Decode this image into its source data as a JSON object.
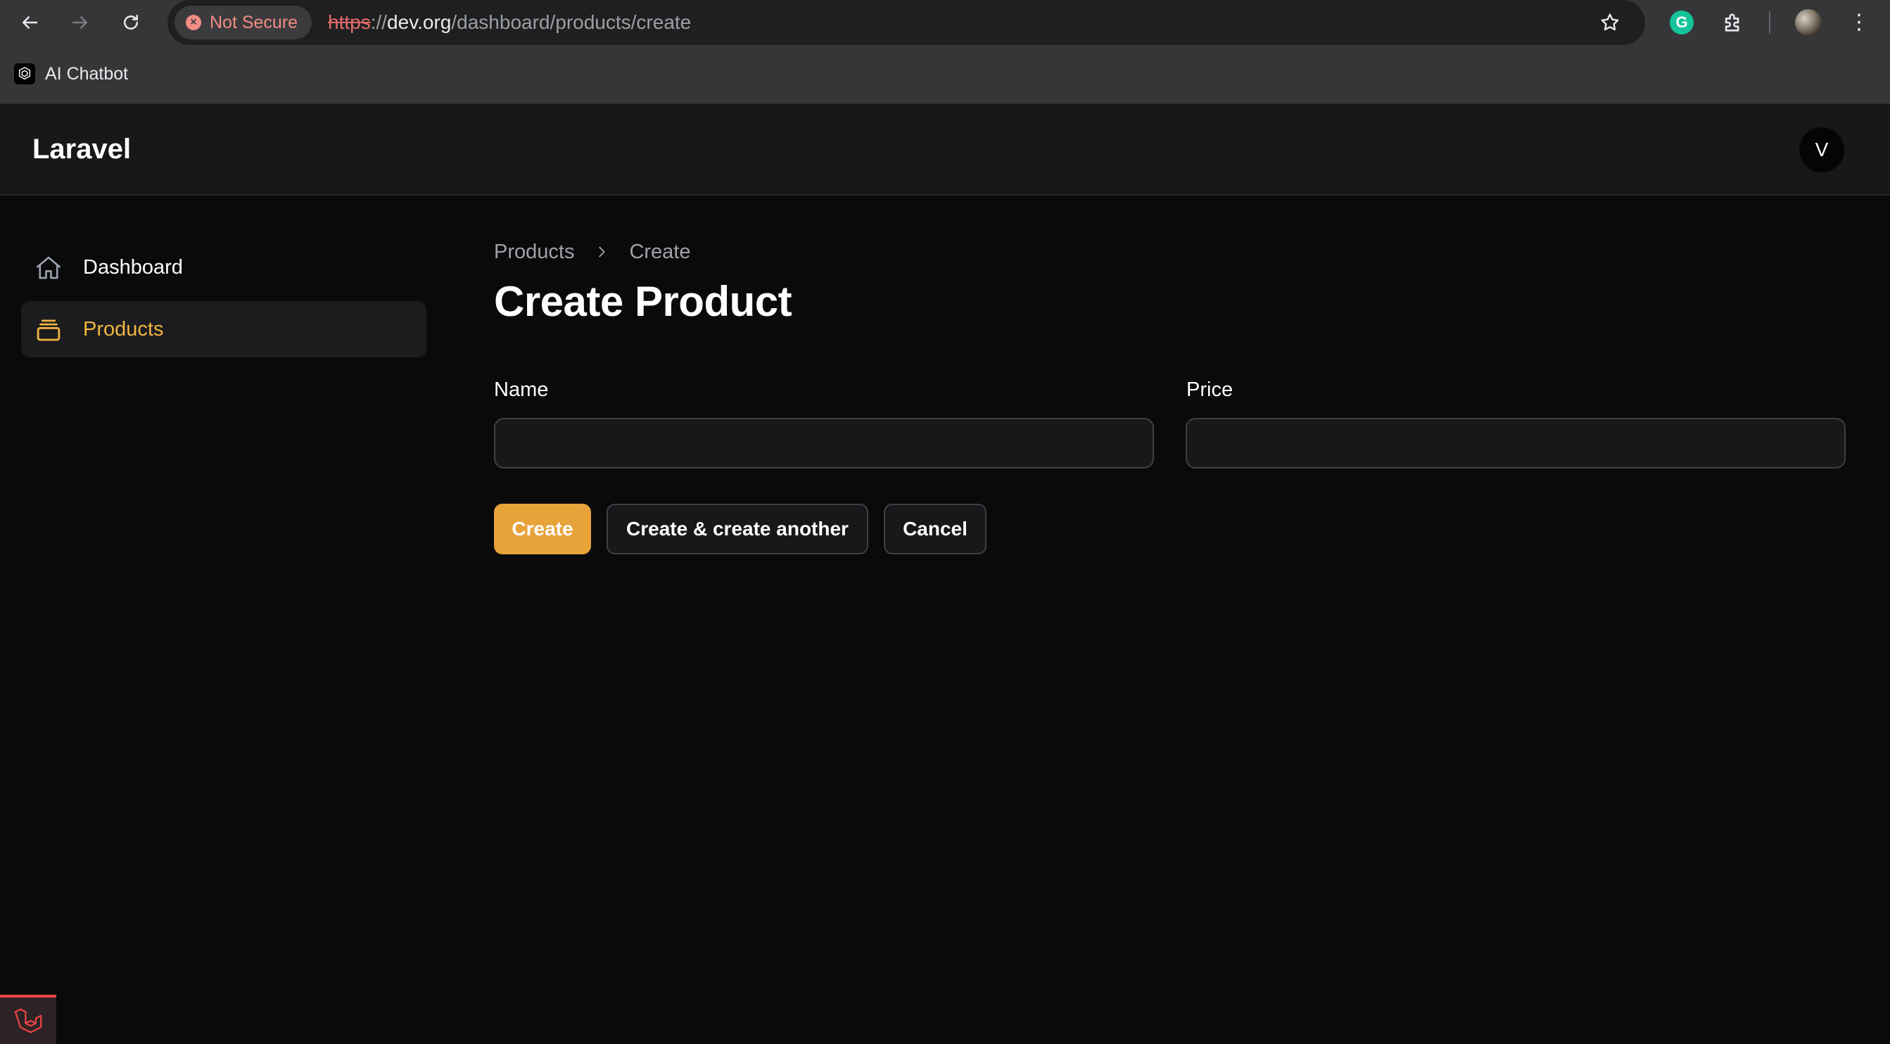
{
  "browser": {
    "security_label": "Not Secure",
    "url_scheme": "https",
    "url_sep": "://",
    "url_host": "dev.org",
    "url_path": "/dashboard/products/create",
    "bookmark_label": "AI Chatbot",
    "grammarly_letter": "G"
  },
  "app": {
    "brand": "Laravel",
    "avatar_initial": "V"
  },
  "sidebar": {
    "items": [
      {
        "label": "Dashboard",
        "icon": "home-icon",
        "active": false
      },
      {
        "label": "Products",
        "icon": "stack-icon",
        "active": true
      }
    ]
  },
  "breadcrumb": {
    "items": [
      "Products",
      "Create"
    ]
  },
  "page": {
    "title": "Create Product"
  },
  "form": {
    "name_label": "Name",
    "name_value": "",
    "price_label": "Price",
    "price_value": "",
    "create_label": "Create",
    "create_another_label": "Create & create another",
    "cancel_label": "Cancel"
  },
  "colors": {
    "accent": "#e8a23a",
    "active_nav_text": "#f2b540",
    "background": "#0a0a0b",
    "header": "#18181b",
    "not_secure": "#f28b82"
  }
}
